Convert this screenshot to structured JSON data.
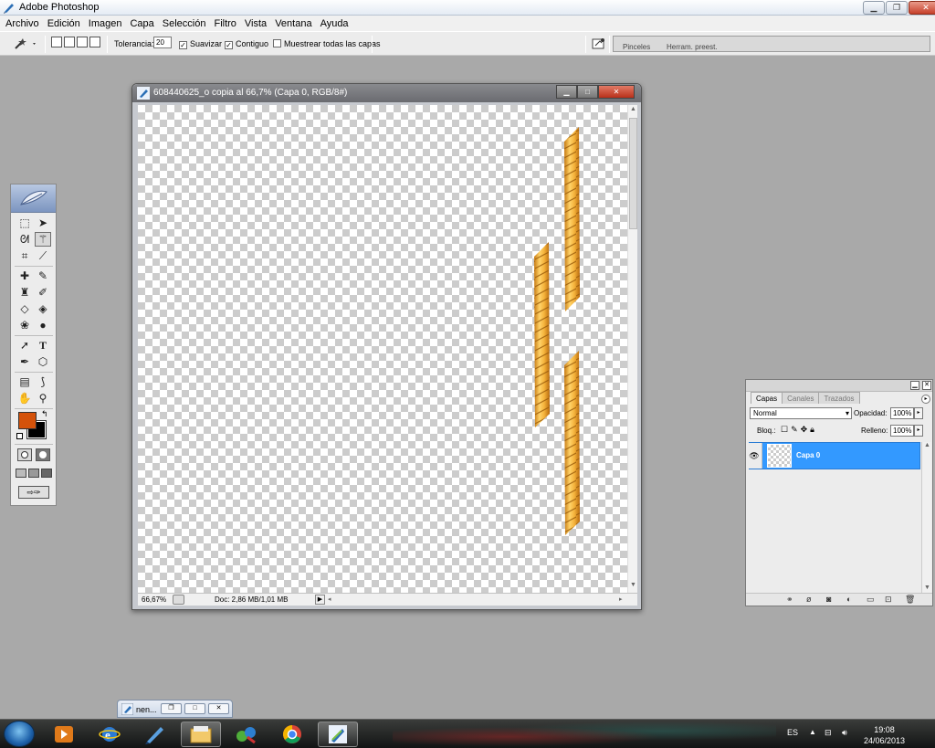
{
  "app": {
    "title": "Adobe Photoshop"
  },
  "menu": [
    "Archivo",
    "Edición",
    "Imagen",
    "Capa",
    "Selección",
    "Filtro",
    "Vista",
    "Ventana",
    "Ayuda"
  ],
  "options": {
    "tolerance_label": "Tolerancia:",
    "tolerance_value": "20",
    "antialias_label": "Suavizar",
    "antialias_checked": true,
    "contiguous_label": "Contiguo",
    "contiguous_checked": true,
    "sample_all_label": "Muestrear todas las capas",
    "sample_all_checked": false,
    "palette_well_tabs": [
      "Pinceles",
      "Herram. preest."
    ]
  },
  "toolbox": {
    "tools": [
      "rect-marquee",
      "move",
      "lasso",
      "magic-wand",
      "crop",
      "slice",
      "healing-brush",
      "brush",
      "clone-stamp",
      "history-brush",
      "eraser",
      "paint-bucket",
      "blur",
      "dodge",
      "path-selection",
      "type",
      "pen",
      "custom-shape",
      "notes",
      "eyedropper",
      "hand",
      "zoom"
    ],
    "active_tool": "magic-wand",
    "foreground_color": "#d4520a",
    "background_color": "#000000"
  },
  "document": {
    "title": "608440625_o copia al 66,7% (Capa 0, RGB/8#)",
    "zoom": "66,67%",
    "doc_size": "Doc: 2,86 MB/1,01 MB"
  },
  "layers_panel": {
    "tabs": [
      "Capas",
      "Canales",
      "Trazados"
    ],
    "active_tab": "Capas",
    "blend_mode": "Normal",
    "opacity_label": "Opacidad:",
    "opacity_value": "100%",
    "lock_label": "Bloq.:",
    "fill_label": "Relleno:",
    "fill_value": "100%",
    "layers": [
      {
        "name": "Capa 0",
        "visible": true,
        "selected": true
      }
    ]
  },
  "minimized_doc": {
    "name": "nen..."
  },
  "taskbar": {
    "language": "ES",
    "time": "19:08",
    "date": "24/06/2013"
  }
}
